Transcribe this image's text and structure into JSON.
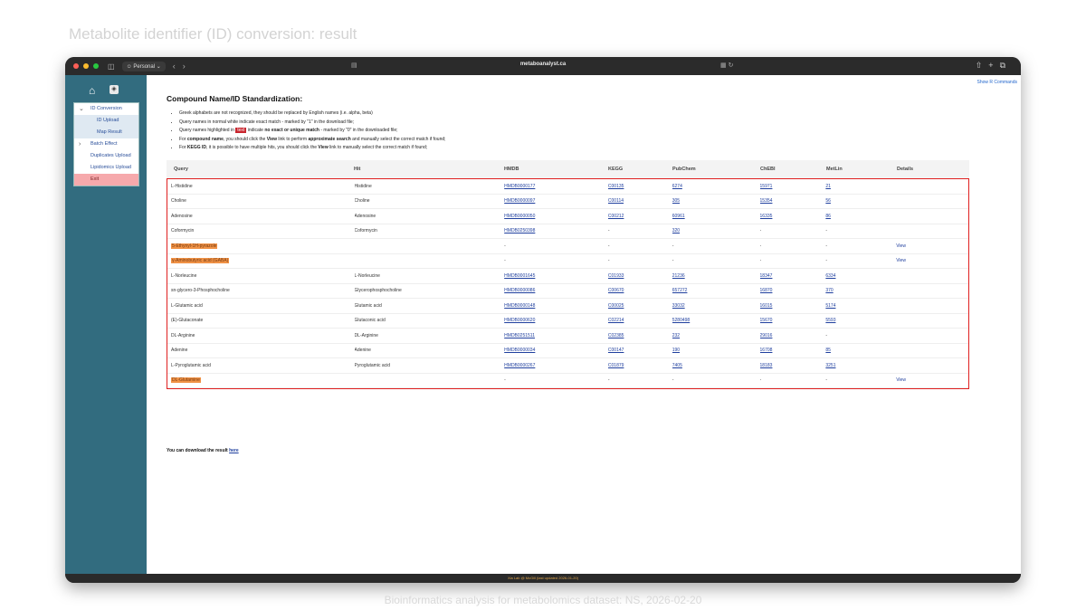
{
  "page": {
    "caption": "Metabolite identifier (ID) conversion: result",
    "footer_caption": "Bioinformatics analysis for metabolomics dataset: NS, 2026-02-20"
  },
  "browser": {
    "profile_label": "Personal",
    "url": "metaboanalyst.ca"
  },
  "sidebar": {
    "home_icon": "home-icon",
    "logo_icon": "metaboanalyst-logo-icon",
    "items": [
      {
        "label": "ID Conversion",
        "expanded": true
      },
      {
        "label": "ID Upload",
        "sub": true
      },
      {
        "label": "Map Result",
        "sub": true
      },
      {
        "label": "Batch Effect",
        "collapsed": true
      },
      {
        "label": "Duplicates Upload"
      },
      {
        "label": "Lipidomics Upload"
      },
      {
        "label": "Exit",
        "exit": true
      }
    ]
  },
  "content": {
    "show_r": "Show R Commands",
    "heading": "Compound Name/ID Standardization:",
    "notes": {
      "n1": "Greek alphabets are not recognized, they should be replaced by English names (i.e. alpha, beta)",
      "n2": "Query names in normal white indicate exact match - marked by \"1\" in the download file;",
      "n3_a": "Query names highlighted in",
      "n3_mark": "text",
      "n3_b": "indicate",
      "n3_bold": "no exact or unique match",
      "n3_c": "- marked by \"0\" in the downloaded file;",
      "n4_a": "For",
      "n4_bold1": "compound name",
      "n4_b": ", you should click the",
      "n4_bold2": "View",
      "n4_c": "link to perform",
      "n4_bold3": "approximate search",
      "n4_d": "and manually select the correct match if found;",
      "n5_a": "For",
      "n5_bold1": "KEGG ID",
      "n5_b": ", it is possible to have multiple hits, you should click the",
      "n5_bold2": "View",
      "n5_c": "link to manually select the correct match if found;"
    },
    "columns": [
      "Query",
      "Hit",
      "HMDB",
      "KEGG",
      "PubChem",
      "ChEBI",
      "MetLin",
      "Details"
    ],
    "rows": [
      {
        "query": "L-Histidine",
        "hit": "Histidine",
        "hmdb": "HMDB0000177",
        "kegg": "C00135",
        "pubchem": "6274",
        "chebi": "15971",
        "metlin": "21",
        "details": "",
        "highlight": false
      },
      {
        "query": "Choline",
        "hit": "Choline",
        "hmdb": "HMDB0000097",
        "kegg": "C00114",
        "pubchem": "305",
        "chebi": "15354",
        "metlin": "56",
        "details": "",
        "highlight": false
      },
      {
        "query": "Adenosine",
        "hit": "Adenosine",
        "hmdb": "HMDB0000050",
        "kegg": "C00212",
        "pubchem": "60961",
        "chebi": "16335",
        "metlin": "86",
        "details": "",
        "highlight": false
      },
      {
        "query": "Coformycin",
        "hit": "Coformycin",
        "hmdb": "HMDB0250398",
        "kegg": "-",
        "pubchem": "320",
        "chebi": "-",
        "metlin": "-",
        "details": "",
        "highlight": false
      },
      {
        "query": "5-Ethynyl-1H-pyrazole",
        "hit": "",
        "hmdb": "-",
        "kegg": "-",
        "pubchem": "-",
        "chebi": "-",
        "metlin": "-",
        "details": "View",
        "highlight": true
      },
      {
        "query": "γ-Aminobutyric acid (GABA)",
        "hit": "",
        "hmdb": "-",
        "kegg": "-",
        "pubchem": "-",
        "chebi": "-",
        "metlin": "-",
        "details": "View",
        "highlight": true
      },
      {
        "query": "L-Norleucine",
        "hit": "L-Norleucine",
        "hmdb": "HMDB0001645",
        "kegg": "C01933",
        "pubchem": "21236",
        "chebi": "18347",
        "metlin": "6334",
        "details": "",
        "highlight": false
      },
      {
        "query": "sn-glycero-3-Phosphocholine",
        "hit": "Glycerophosphocholine",
        "hmdb": "HMDB0000086",
        "kegg": "C00670",
        "pubchem": "657272",
        "chebi": "16870",
        "metlin": "370",
        "details": "",
        "highlight": false
      },
      {
        "query": "L-Glutamic acid",
        "hit": "Glutamic acid",
        "hmdb": "HMDB0000148",
        "kegg": "C00025",
        "pubchem": "33032",
        "chebi": "16015",
        "metlin": "5174",
        "details": "",
        "highlight": false
      },
      {
        "query": "(E)-Glutaconate",
        "hit": "Glutaconic acid",
        "hmdb": "HMDB0000620",
        "kegg": "C02214",
        "pubchem": "5280498",
        "chebi": "15670",
        "metlin": "5593",
        "details": "",
        "highlight": false
      },
      {
        "query": "DL-Arginine",
        "hit": "DL-Arginine",
        "hmdb": "HMDB0251511",
        "kegg": "C02385",
        "pubchem": "232",
        "chebi": "29016",
        "metlin": "-",
        "details": "",
        "highlight": false
      },
      {
        "query": "Adenine",
        "hit": "Adenine",
        "hmdb": "HMDB0000034",
        "kegg": "C00147",
        "pubchem": "190",
        "chebi": "16708",
        "metlin": "85",
        "details": "",
        "highlight": false
      },
      {
        "query": "L-Pyroglutamic acid",
        "hit": "Pyroglutamic acid",
        "hmdb": "HMDB0000267",
        "kegg": "C01879",
        "pubchem": "7405",
        "chebi": "18183",
        "metlin": "3251",
        "details": "",
        "highlight": false
      },
      {
        "query": "DL-Glutamine",
        "hit": "",
        "hmdb": "-",
        "kegg": "-",
        "pubchem": "-",
        "chebi": "-",
        "metlin": "-",
        "details": "View",
        "highlight": true
      }
    ],
    "download_text": "You can download the result",
    "download_link": "here"
  },
  "status": {
    "text": "Xia Lab @ McGill   (last updated 2026-01-20)"
  },
  "colors": {
    "sidebar": "#326c7f",
    "highlight": "#f09246",
    "selection_border": "#e02020",
    "link": "#1f3f9e"
  }
}
